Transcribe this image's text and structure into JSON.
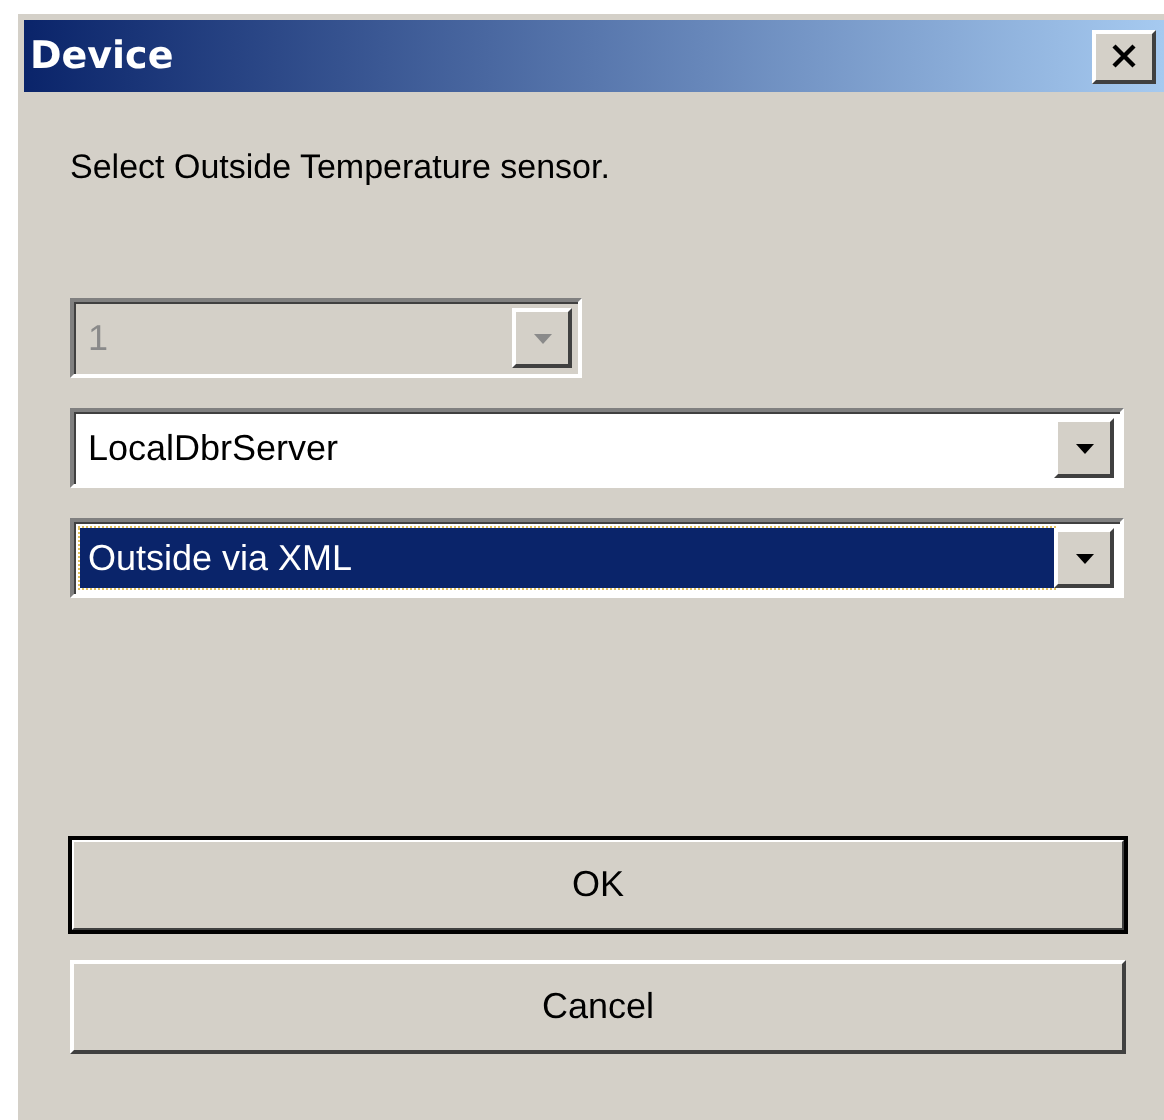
{
  "window": {
    "title": "Device"
  },
  "message": "Select Outside Temperature sensor.",
  "combos": [
    {
      "value": "1",
      "disabled": true,
      "focused": false,
      "wide": false
    },
    {
      "value": "LocalDbrServer",
      "disabled": false,
      "focused": false,
      "wide": true
    },
    {
      "value": "Outside via XML",
      "disabled": false,
      "focused": true,
      "wide": true
    }
  ],
  "buttons": [
    {
      "label": "OK",
      "default": true
    },
    {
      "label": "Cancel",
      "default": false
    }
  ]
}
